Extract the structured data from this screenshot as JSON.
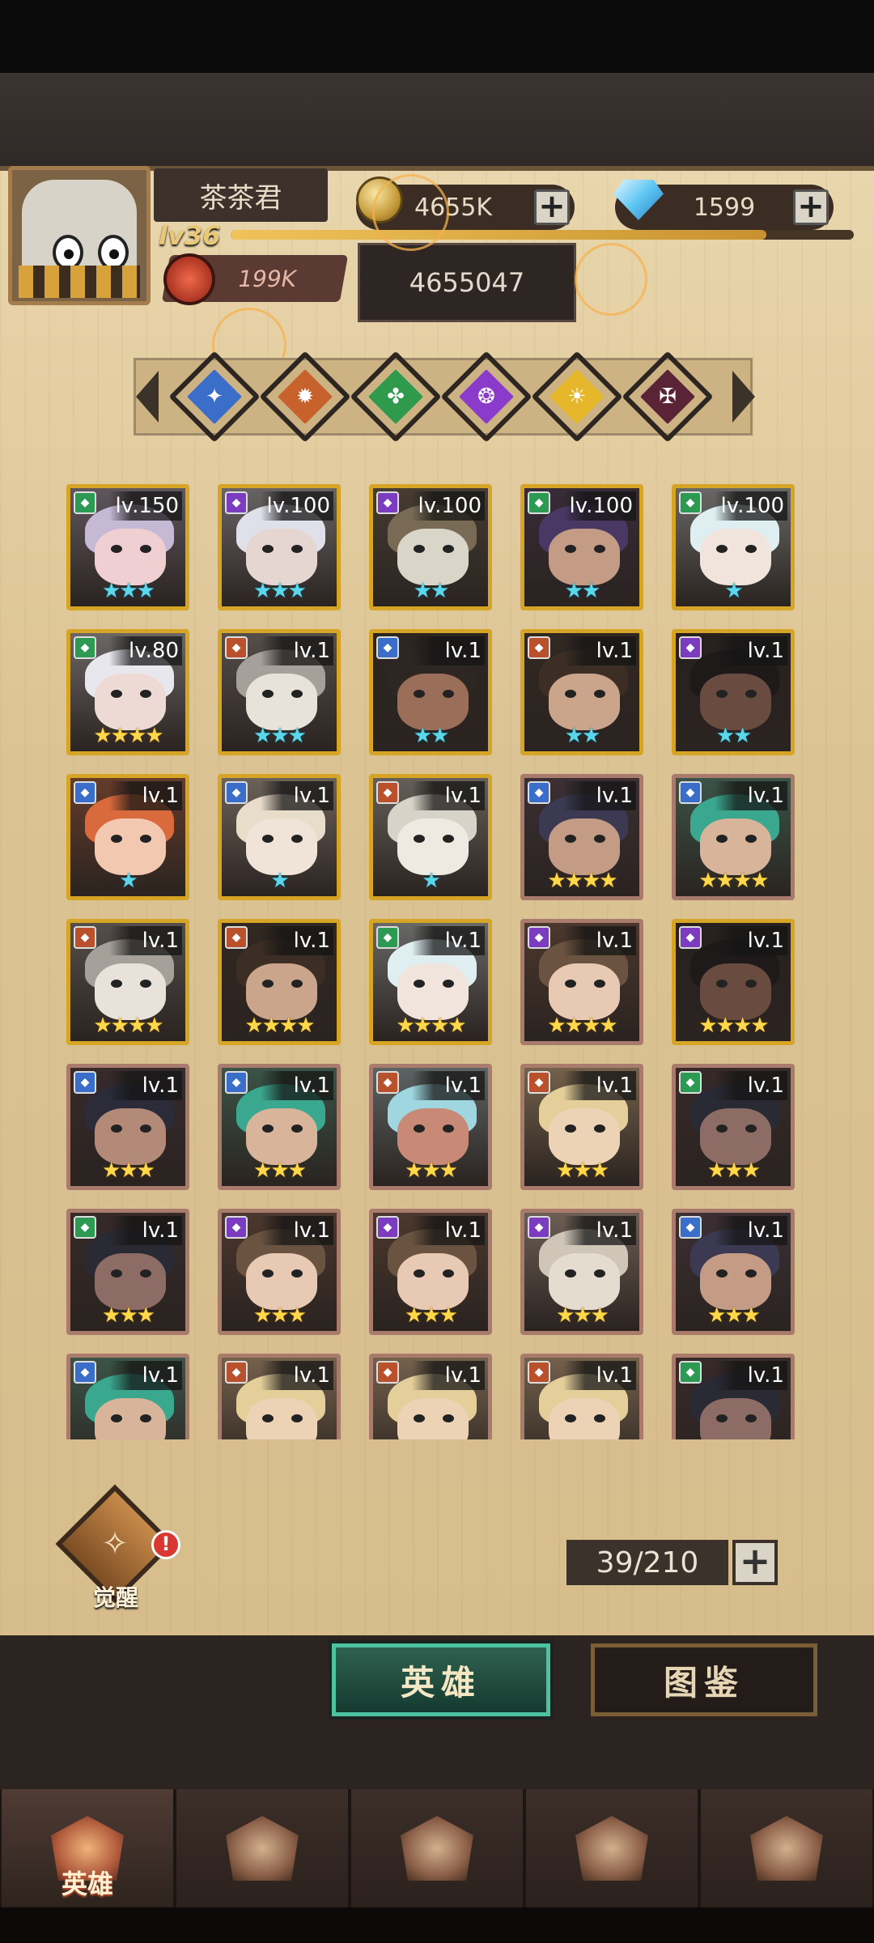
{
  "player": {
    "name": "茶茶君",
    "level": "lv36",
    "xp_fraction": 0.86,
    "power": "199K",
    "gold": "4655K",
    "gold_tooltip": "4655047",
    "diamonds": "1599"
  },
  "factions": [
    {
      "name": "faction-blue",
      "color": "#3b6ec8",
      "glyph": "✦"
    },
    {
      "name": "faction-orange",
      "color": "#c8622d",
      "glyph": "✹"
    },
    {
      "name": "faction-green",
      "color": "#2f9a4b",
      "glyph": "✤"
    },
    {
      "name": "faction-purple",
      "color": "#8a3bc9",
      "glyph": "❂"
    },
    {
      "name": "faction-gold",
      "color": "#e6b62b",
      "glyph": "☀"
    },
    {
      "name": "faction-dark",
      "color": "#5a2436",
      "glyph": "✠"
    }
  ],
  "heroes": [
    {
      "lv": "lv.150",
      "stars": "★★★",
      "star_color": "blue",
      "rarity": "gold",
      "cls": "#2c9a52",
      "hair": "#c6b9d6",
      "skin": "#f0cfd2"
    },
    {
      "lv": "lv.100",
      "stars": "★★★",
      "star_color": "blue",
      "rarity": "gold",
      "cls": "#7b3cc0",
      "hair": "#e0e0ea",
      "skin": "#e5d6d2"
    },
    {
      "lv": "lv.100",
      "stars": "★★",
      "star_color": "blue",
      "rarity": "gold",
      "cls": "#7b3cc0",
      "hair": "#786a55",
      "skin": "#d9d5c9"
    },
    {
      "lv": "lv.100",
      "stars": "★★",
      "star_color": "blue",
      "rarity": "gold",
      "cls": "#2c9a52",
      "hair": "#4a3864",
      "skin": "#c49c86"
    },
    {
      "lv": "lv.100",
      "stars": "★",
      "star_color": "blue",
      "rarity": "gold",
      "cls": "#2c9a52",
      "hair": "#dfeef0",
      "skin": "#f1e4dc"
    },
    {
      "lv": "lv.80",
      "stars": "★★★★",
      "star_color": "gold",
      "rarity": "gold",
      "cls": "#2c9a52",
      "hair": "#e9e7ee",
      "skin": "#eedad5"
    },
    {
      "lv": "lv.1",
      "stars": "★★★",
      "star_color": "blue",
      "rarity": "gold",
      "cls": "#b9522c",
      "hair": "#a6a09a",
      "skin": "#e8e2da"
    },
    {
      "lv": "lv.1",
      "stars": "★★",
      "star_color": "blue",
      "rarity": "gold",
      "cls": "#3b6ec8",
      "hair": "#2e2622",
      "skin": "#9a6e58"
    },
    {
      "lv": "lv.1",
      "stars": "★★",
      "star_color": "blue",
      "rarity": "gold",
      "cls": "#b9522c",
      "hair": "#3c2e24",
      "skin": "#caa58c"
    },
    {
      "lv": "lv.1",
      "stars": "★★",
      "star_color": "blue",
      "rarity": "gold",
      "cls": "#7b3cc0",
      "hair": "#1e1a1a",
      "skin": "#6a4b40"
    },
    {
      "lv": "lv.1",
      "stars": "★",
      "star_color": "blue",
      "rarity": "gold",
      "cls": "#3b6ec8",
      "hair": "#d86a3c",
      "skin": "#f2c9b0"
    },
    {
      "lv": "lv.1",
      "stars": "★",
      "star_color": "blue",
      "rarity": "gold",
      "cls": "#3b6ec8",
      "hair": "#e8dccb",
      "skin": "#f0e4d8"
    },
    {
      "lv": "lv.1",
      "stars": "★",
      "star_color": "blue",
      "rarity": "gold",
      "cls": "#b9522c",
      "hair": "#d8d3c8",
      "skin": "#eeeae2"
    },
    {
      "lv": "lv.1",
      "stars": "★★★★",
      "star_color": "gold",
      "rarity": "brown",
      "cls": "#3b6ec8",
      "hair": "#3b3a52",
      "skin": "#c49c86"
    },
    {
      "lv": "lv.1",
      "stars": "★★★★",
      "star_color": "gold",
      "rarity": "brown",
      "cls": "#3b6ec8",
      "hair": "#3aa88e",
      "skin": "#d7b49a"
    },
    {
      "lv": "lv.1",
      "stars": "★★★★",
      "star_color": "gold",
      "rarity": "gold",
      "cls": "#b9522c",
      "hair": "#a6a09a",
      "skin": "#e8e2da"
    },
    {
      "lv": "lv.1",
      "stars": "★★★★",
      "star_color": "gold",
      "rarity": "gold",
      "cls": "#b9522c",
      "hair": "#3c2e24",
      "skin": "#caa58c"
    },
    {
      "lv": "lv.1",
      "stars": "★★★★",
      "star_color": "gold",
      "rarity": "gold",
      "cls": "#2c9a52",
      "hair": "#dfeef0",
      "skin": "#f1e4dc"
    },
    {
      "lv": "lv.1",
      "stars": "★★★★",
      "star_color": "gold",
      "rarity": "brown",
      "cls": "#7b3cc0",
      "hair": "#6a5340",
      "skin": "#e8c9b4"
    },
    {
      "lv": "lv.1",
      "stars": "★★★★",
      "star_color": "gold",
      "rarity": "gold",
      "cls": "#7b3cc0",
      "hair": "#1e1a1a",
      "skin": "#6a4b40"
    },
    {
      "lv": "lv.1",
      "stars": "★★★",
      "star_color": "gold",
      "rarity": "brown",
      "cls": "#3b6ec8",
      "hair": "#2b2b3a",
      "skin": "#b38a78"
    },
    {
      "lv": "lv.1",
      "stars": "★★★",
      "star_color": "gold",
      "rarity": "brown",
      "cls": "#3b6ec8",
      "hair": "#3aa88e",
      "skin": "#d7b49a"
    },
    {
      "lv": "lv.1",
      "stars": "★★★",
      "star_color": "gold",
      "rarity": "brown",
      "cls": "#b9522c",
      "hair": "#9fd6e0",
      "skin": "#c88a76"
    },
    {
      "lv": "lv.1",
      "stars": "★★★",
      "star_color": "gold",
      "rarity": "brown",
      "cls": "#b9522c",
      "hair": "#e4cf9a",
      "skin": "#ecd3b6"
    },
    {
      "lv": "lv.1",
      "stars": "★★★",
      "star_color": "gold",
      "rarity": "brown",
      "cls": "#2c9a52",
      "hair": "#2a2a34",
      "skin": "#8c6c64"
    },
    {
      "lv": "lv.1",
      "stars": "★★★",
      "star_color": "gold",
      "rarity": "brown",
      "cls": "#2c9a52",
      "hair": "#2a2a34",
      "skin": "#8c6c64"
    },
    {
      "lv": "lv.1",
      "stars": "★★★",
      "star_color": "gold",
      "rarity": "brown",
      "cls": "#7b3cc0",
      "hair": "#6a5340",
      "skin": "#e8c9b4"
    },
    {
      "lv": "lv.1",
      "stars": "★★★",
      "star_color": "gold",
      "rarity": "brown",
      "cls": "#7b3cc0",
      "hair": "#6a5340",
      "skin": "#e8c9b4"
    },
    {
      "lv": "lv.1",
      "stars": "★★★",
      "star_color": "gold",
      "rarity": "brown",
      "cls": "#7b3cc0",
      "hair": "#cfc6b8",
      "skin": "#e5dcd0"
    },
    {
      "lv": "lv.1",
      "stars": "★★★",
      "star_color": "gold",
      "rarity": "brown",
      "cls": "#3b6ec8",
      "hair": "#3b3a52",
      "skin": "#c49c86"
    },
    {
      "lv": "lv.1",
      "stars": "",
      "star_color": "gold",
      "rarity": "brown",
      "cls": "#3b6ec8",
      "hair": "#3aa88e",
      "skin": "#d7b49a"
    },
    {
      "lv": "lv.1",
      "stars": "",
      "star_color": "gold",
      "rarity": "brown",
      "cls": "#b9522c",
      "hair": "#e4cf9a",
      "skin": "#ecd3b6"
    },
    {
      "lv": "lv.1",
      "stars": "",
      "star_color": "gold",
      "rarity": "brown",
      "cls": "#b9522c",
      "hair": "#e4cf9a",
      "skin": "#ecd3b6"
    },
    {
      "lv": "lv.1",
      "stars": "",
      "star_color": "gold",
      "rarity": "brown",
      "cls": "#b9522c",
      "hair": "#e4cf9a",
      "skin": "#ecd3b6"
    },
    {
      "lv": "lv.1",
      "stars": "",
      "star_color": "gold",
      "rarity": "brown",
      "cls": "#2c9a52",
      "hair": "#2a2a34",
      "skin": "#8c6c64"
    }
  ],
  "awaken_label": "觉醒",
  "awaken_alert": "!",
  "capacity": "39/210",
  "tabs": {
    "heroes": "英雄",
    "atlas": "图鉴"
  },
  "nav": [
    {
      "label": "英雄",
      "icon": "helmet-icon",
      "active": true
    },
    {
      "label": "",
      "icon": "banner-icon",
      "active": false
    },
    {
      "label": "",
      "icon": "crossed-swords-icon",
      "active": false
    },
    {
      "label": "",
      "icon": "tower-icon",
      "active": false
    },
    {
      "label": "",
      "icon": "guild-emblem-icon",
      "active": false
    }
  ],
  "plus_symbol": "+"
}
